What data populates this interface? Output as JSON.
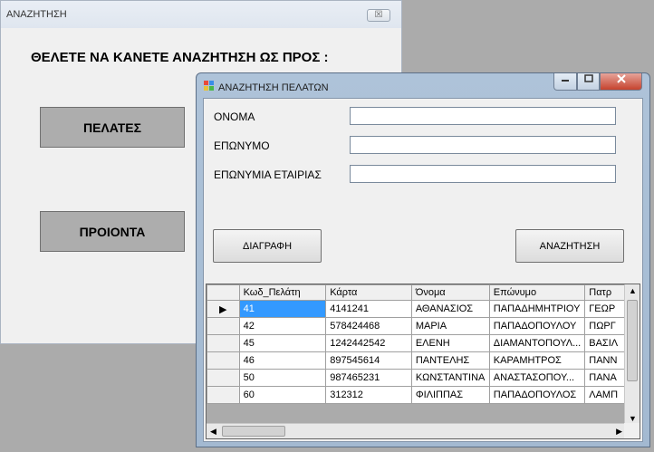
{
  "back_window": {
    "title": "ΑΝΑΖΗΤΗΣΗ",
    "close_glyph": "☒",
    "question": "ΘΕΛΕΤΕ ΝΑ ΚΑΝΕΤΕ ΑΝΑΖΗΤΗΣΗ ΩΣ ΠΡΟΣ :",
    "customers_button": "ΠΕΛΑΤΕΣ",
    "products_button": "ΠΡΟΙΟΝΤΑ"
  },
  "search_window": {
    "title": "ΑΝΑΖΗΤΗΣΗ ΠΕΛΑΤΩΝ",
    "fields": {
      "name_label": "ΟΝΟΜΑ",
      "name_value": "",
      "surname_label": "ΕΠΩΝΥΜΟ",
      "surname_value": "",
      "company_label": "ΕΠΩΝΥΜΙΑ ΕΤΑΙΡΙΑΣ",
      "company_value": ""
    },
    "delete_button": "ΔΙΑΓΡΑΦΗ",
    "search_button": "ΑΝΑΖΗΤΗΣΗ",
    "grid": {
      "columns": [
        "Κωδ_Πελάτη",
        "Κάρτα",
        "Όνομα",
        "Επώνυμο",
        "Πατρ"
      ],
      "rows": [
        [
          "41",
          "4141241",
          "ΑΘΑΝΑΣΙΟΣ",
          "ΠΑΠΑΔΗΜΗΤΡΙΟΥ",
          "ΓΕΩΡ"
        ],
        [
          "42",
          "578424468",
          "ΜΑΡΙΑ",
          "ΠΑΠΑΔΟΠΟΥΛΟΥ",
          "ΠΩΡΓ"
        ],
        [
          "45",
          "1242442542",
          "ΕΛΕΝΗ",
          "ΔΙΑΜΑΝΤΟΠΟΥΛ...",
          "ΒΑΣΙΛ"
        ],
        [
          "46",
          "897545614",
          "ΠΑΝΤΕΛΗΣ",
          "ΚΑΡΑΜΗΤΡΟΣ",
          "ΠΑΝΝ"
        ],
        [
          "50",
          "987465231",
          "ΚΩΝΣΤΑΝΤΙΝΑ",
          "ΑΝΑΣΤΑΣΟΠΟΥ...",
          "ΠΑΝΑ"
        ],
        [
          "60",
          "312312",
          "ΦΙΛΙΠΠΑΣ",
          "ΠΑΠΑΔΟΠΟΥΛΟΣ",
          "ΛΑΜΠ"
        ]
      ],
      "current_row_marker": "▶",
      "selected_row": 0
    }
  }
}
